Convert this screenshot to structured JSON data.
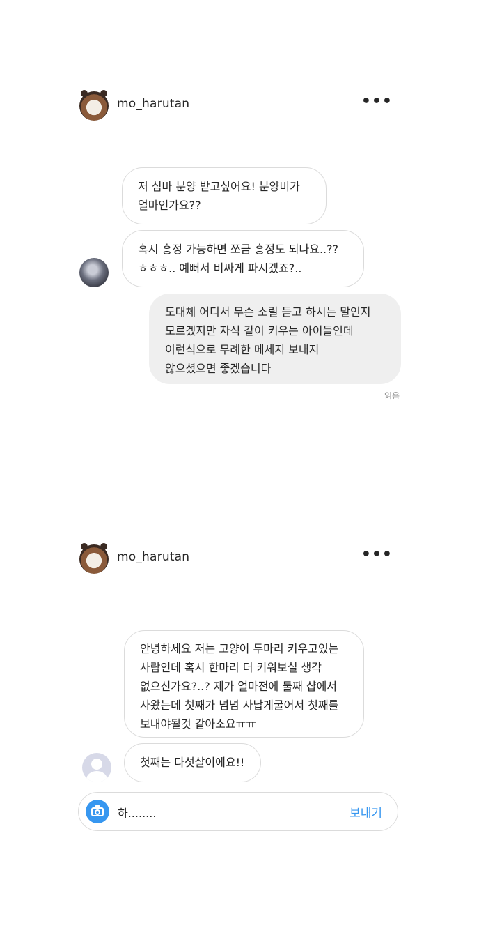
{
  "thread1": {
    "username": "mo_harutan",
    "more_icon": "more-dots-icon",
    "messages": [
      {
        "side": "received",
        "text": "저 심바 분양 받고싶어요! 분양비가\n얼마인가요??"
      },
      {
        "side": "received",
        "text": "혹시 흥정 가능하면 쪼금 흥정도 되나요..??\nㅎㅎㅎ.. 예뻐서 비싸게 파시겠죠?.."
      },
      {
        "side": "sent",
        "text": "도대체 어디서 무슨 소릴 듣고 하시는 말인지\n모르겠지만 자식 같이 키우는 아이들인데\n이런식으로 무례한 메세지 보내지\n않으셨으면 좋겠습니다"
      }
    ],
    "seen_label": "읽음"
  },
  "thread2": {
    "username": "mo_harutan",
    "more_icon": "more-dots-icon",
    "messages": [
      {
        "side": "received",
        "text": "안녕하세요 저는 고양이 두마리 키우고있는\n사람인데 혹시 한마리 더 키워보실 생각\n없으신가요?..? 제가 얼마전에 둘째 샵에서\n사왔는데 첫째가 넘넘 사납게굴어서 첫째를\n보내야될것 같아소요ㅠㅠ"
      },
      {
        "side": "received",
        "text": "첫째는 다섯살이에요!!"
      }
    ],
    "composer": {
      "camera_icon": "camera-icon",
      "typed_text": "하........",
      "send_label": "보내기"
    }
  }
}
